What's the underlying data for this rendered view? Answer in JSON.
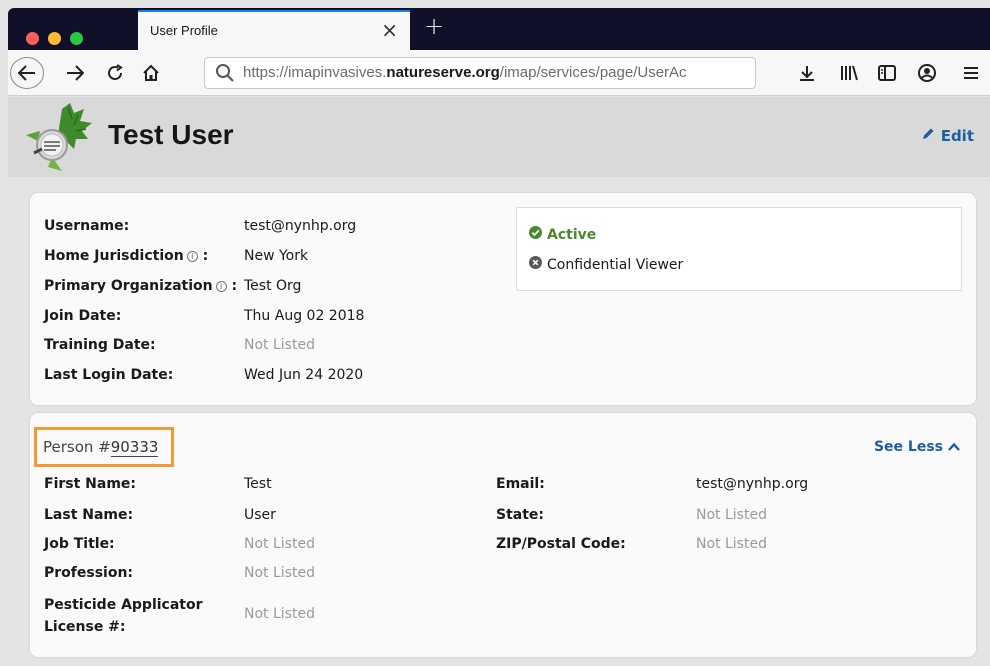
{
  "window": {
    "tab_title": "User Profile",
    "tab_close": "×",
    "new_tab": "+",
    "url_prefix": "https://imapinvasives.",
    "url_domain": "natureserve.org",
    "url_path": "/imap/services/page/UserAc"
  },
  "header": {
    "title": "Test User",
    "edit_label": "Edit"
  },
  "account": {
    "fields": [
      {
        "label": "Username:",
        "value": "test@nynhp.org",
        "info": false,
        "missing": false
      },
      {
        "label": "Home Jurisdiction",
        "value": "New York",
        "info": true,
        "missing": false
      },
      {
        "label": "Primary Organization",
        "value": "Test Org",
        "info": true,
        "missing": false
      },
      {
        "label": "Join Date:",
        "value": "Thu Aug 02 2018",
        "info": false,
        "missing": false
      },
      {
        "label": "Training Date:",
        "value": "Not Listed",
        "info": false,
        "missing": true
      },
      {
        "label": "Last Login Date:",
        "value": "Wed Jun 24 2020",
        "info": false,
        "missing": false
      }
    ],
    "info_colon": ":",
    "status_active": "Active",
    "status_role": "Confidential Viewer"
  },
  "person": {
    "heading_prefix": "Person #",
    "heading_number": "90333",
    "see_less_label": "See Less",
    "left_fields": [
      {
        "label": "First Name:",
        "value": "Test",
        "missing": false
      },
      {
        "label": "Last Name:",
        "value": "User",
        "missing": false
      },
      {
        "label": "Job Title:",
        "value": "Not Listed",
        "missing": true
      },
      {
        "label": "Profession:",
        "value": "Not Listed",
        "missing": true
      }
    ],
    "license_label_line1": "Pesticide Applicator",
    "license_label_line2": "License #:",
    "license_value": "Not Listed",
    "right_fields": [
      {
        "label": "Email:",
        "value": "test@nynhp.org",
        "missing": false
      },
      {
        "label": "State:",
        "value": "Not Listed",
        "missing": true
      },
      {
        "label": "ZIP/Postal Code:",
        "value": "Not Listed",
        "missing": true
      }
    ]
  },
  "colors": {
    "accent_blue": "#1d5fa6",
    "active_green": "#4a8a2c",
    "highlight_orange": "#f39a35",
    "missing_gray": "#9a9a9a"
  },
  "icons": {
    "back": "back-arrow-icon",
    "forward": "forward-arrow-icon",
    "reload": "reload-icon",
    "home": "home-icon",
    "search": "search-icon",
    "download": "download-icon",
    "library": "library-icon",
    "sidebar": "sidebar-icon",
    "account": "account-icon",
    "menu": "hamburger-menu-icon",
    "edit": "pencil-icon",
    "active": "check-circle-icon",
    "viewer": "x-circle-icon",
    "info": "info-icon",
    "see_less": "chevron-up-icon"
  }
}
